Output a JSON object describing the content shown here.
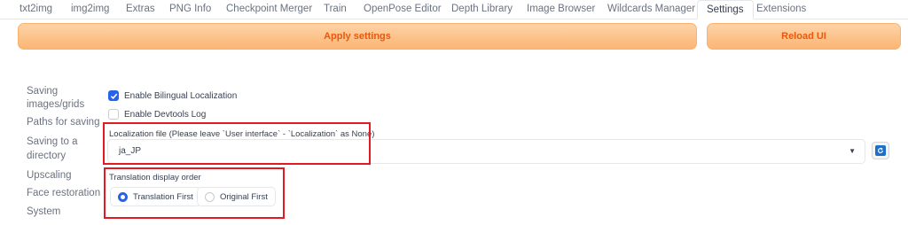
{
  "tabs": [
    {
      "label": "txt2img"
    },
    {
      "label": "img2img"
    },
    {
      "label": "Extras"
    },
    {
      "label": "PNG Info"
    },
    {
      "label": "Checkpoint Merger"
    },
    {
      "label": "Train"
    },
    {
      "label": "OpenPose Editor"
    },
    {
      "label": "Depth Library"
    },
    {
      "label": "Image Browser"
    },
    {
      "label": "Wildcards Manager"
    },
    {
      "label": "Settings"
    },
    {
      "label": "Extensions"
    }
  ],
  "active_tab": "Settings",
  "toolbar": {
    "apply_label": "Apply settings",
    "reload_label": "Reload UI"
  },
  "sidebar": {
    "items": [
      {
        "label": "Saving"
      },
      {
        "label": "images/grids"
      },
      {
        "label": "Paths for saving"
      },
      {
        "label": "Saving to a"
      },
      {
        "label": "directory"
      },
      {
        "label": "Upscaling"
      },
      {
        "label": "Face restoration"
      },
      {
        "label": "System"
      }
    ]
  },
  "settings": {
    "bilingual": {
      "label": "Enable Bilingual Localization",
      "checked": true
    },
    "devtools": {
      "label": "Enable Devtools Log",
      "checked": false
    },
    "localization": {
      "label": "Localization file (Please leave `User interface` - `Localization` as None)",
      "value": "ja_JP"
    },
    "display_order": {
      "label": "Translation display order",
      "options": [
        {
          "label": "Translation First",
          "selected": true
        },
        {
          "label": "Original First",
          "selected": false
        }
      ]
    }
  },
  "colors": {
    "accent": "#2563eb",
    "button_text": "#ea580c",
    "highlight": "#e21b23"
  }
}
